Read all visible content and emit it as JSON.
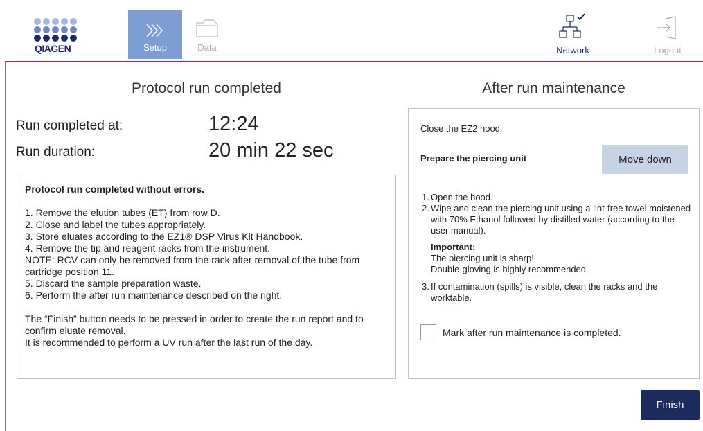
{
  "brand": {
    "wordmark": "QIAGEN",
    "colors": {
      "dots_light": "#a8b7e0",
      "dots_dark": "#1b2a6b",
      "rule": "#c41e3a"
    }
  },
  "nav": {
    "tabs": [
      {
        "label": "Setup",
        "icon": "chevrons-right-icon",
        "active": true
      },
      {
        "label": "Data",
        "icon": "folder-icon",
        "active": false
      }
    ],
    "network": {
      "label": "Network",
      "icon": "network-check-icon"
    },
    "logout": {
      "label": "Logout",
      "icon": "logout-icon",
      "enabled": false
    }
  },
  "left": {
    "title": "Protocol run completed",
    "completed_label": "Run completed at:",
    "completed_value": "12:24",
    "duration_label": "Run duration:",
    "duration_value": "20 min 22 sec",
    "box": {
      "heading": "Protocol run completed without errors.",
      "lines": [
        "1. Remove the elution tubes (ET) from row D.",
        "2. Close and label the tubes appropriately.",
        "3. Store eluates according to the EZ1® DSP Virus Kit Handbook.",
        "4. Remove the tip and reagent racks from the instrument.",
        "NOTE: RCV can only be removed from the rack after removal of the tube from cartridge position 11.",
        "5. Discard the sample preparation waste.",
        "6. Perform the after run maintenance described on the right."
      ],
      "footer": [
        "The “Finish” button needs to be pressed in order to create the run report and to confirm eluate removal.",
        "It is recommended to perform a UV run after the last run of the day."
      ]
    }
  },
  "right": {
    "title": "After run maintenance",
    "close_text": "Close the EZ2 hood.",
    "prepare_label": "Prepare the piercing unit",
    "move_down_label": "Move down",
    "steps": [
      {
        "num": "1.",
        "text": "Open the hood."
      },
      {
        "num": "2.",
        "text": "Wipe and clean the piercing unit using a lint-free towel moistened with 70% Ethanol followed by distilled water (according to the user manual)."
      }
    ],
    "important": {
      "heading": "Important:",
      "line1": "The piercing unit is sharp!",
      "line2": "Double-gloving is highly recommended."
    },
    "step3": {
      "num": "3.",
      "text": "If contamination (spills) is visible, clean the racks and the worktable."
    },
    "checkbox_label": "Mark after run maintenance is completed.",
    "checkbox_checked": false
  },
  "finish_label": "Finish"
}
